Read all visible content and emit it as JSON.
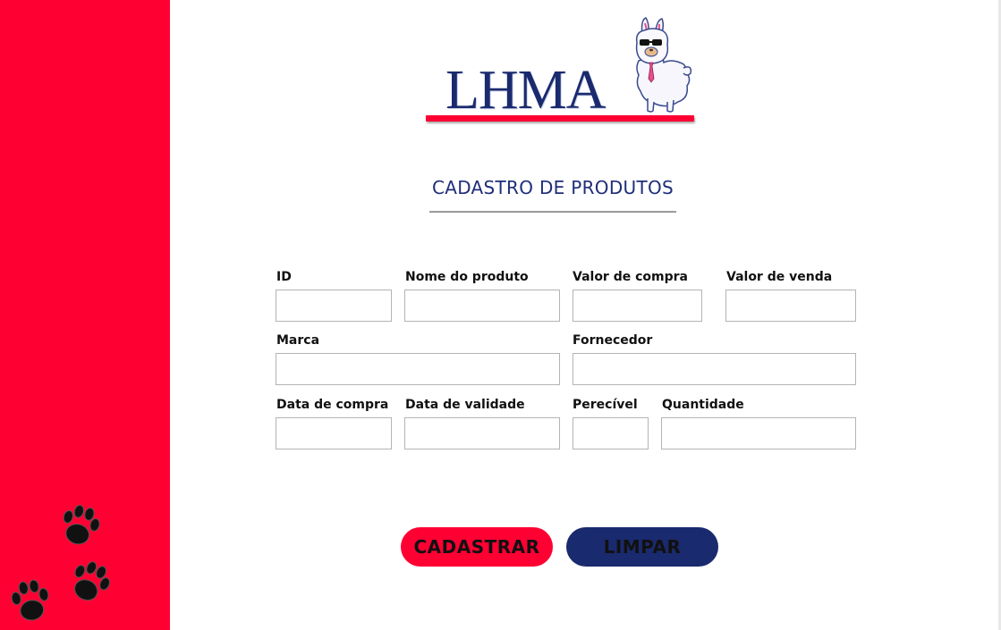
{
  "logo": {
    "text": "LHMA"
  },
  "page": {
    "title": "CADASTRO DE PRODUTOS"
  },
  "form": {
    "id": {
      "label": "ID",
      "value": ""
    },
    "nome_produto": {
      "label": "Nome do produto",
      "value": ""
    },
    "valor_compra": {
      "label": "Valor de compra",
      "value": ""
    },
    "valor_venda": {
      "label": "Valor de venda",
      "value": ""
    },
    "marca": {
      "label": "Marca",
      "value": ""
    },
    "fornecedor": {
      "label": "Fornecedor",
      "value": ""
    },
    "data_compra": {
      "label": "Data de compra",
      "value": ""
    },
    "data_validade": {
      "label": "Data de validade",
      "value": ""
    },
    "perecivel": {
      "label": "Perecível",
      "value": ""
    },
    "quantidade": {
      "label": "Quantidade",
      "value": ""
    }
  },
  "buttons": {
    "cadastrar": "CADASTRAR",
    "limpar": "LIMPAR"
  },
  "colors": {
    "sidebar": "#ff0033",
    "navy": "#1a2a6e",
    "accent": "#ff0033"
  },
  "icons": {
    "decoration": "paw-print-icon",
    "mascot": "llama-icon"
  }
}
